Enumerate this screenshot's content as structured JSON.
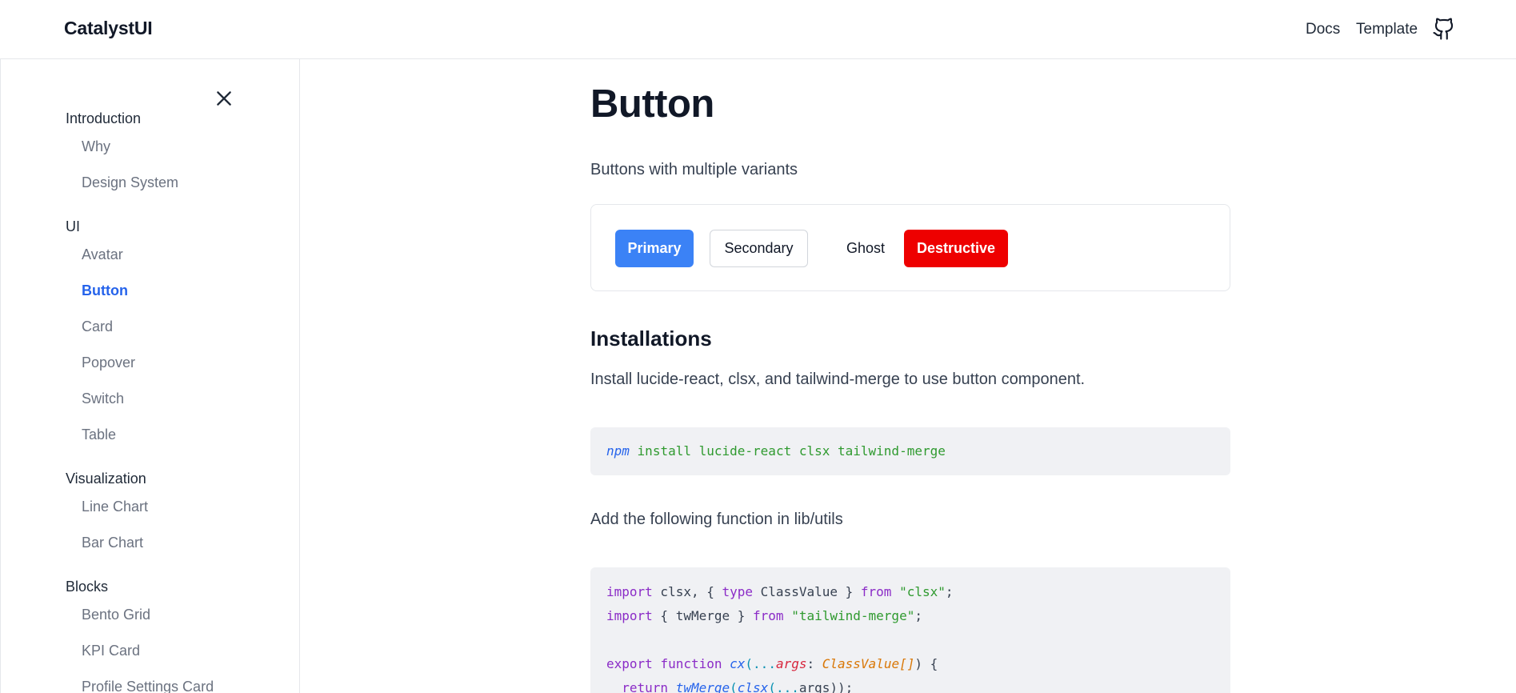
{
  "header": {
    "brand": "CatalystUI",
    "links": [
      "Docs",
      "Template"
    ],
    "github_icon": "github-icon"
  },
  "sidebar": {
    "close_icon": "close-icon",
    "groups": [
      {
        "label": "Introduction",
        "items": [
          "Why",
          "Design System"
        ]
      },
      {
        "label": "UI",
        "items": [
          "Avatar",
          "Button",
          "Card",
          "Popover",
          "Switch",
          "Table"
        ]
      },
      {
        "label": "Visualization",
        "items": [
          "Line Chart",
          "Bar Chart"
        ]
      },
      {
        "label": "Blocks",
        "items": [
          "Bento Grid",
          "KPI Card",
          "Profile Settings Card"
        ]
      }
    ],
    "active_item": "Button"
  },
  "main": {
    "title": "Button",
    "subtitle": "Buttons with multiple variants",
    "buttons": {
      "primary": "Primary",
      "secondary": "Secondary",
      "ghost": "Ghost",
      "destructive": "Destructive"
    },
    "installations_heading": "Installations",
    "install_text": "Install lucide-react, clsx, and tailwind-merge to use button component.",
    "install_cmd": {
      "bin": "npm",
      "args": "install lucide-react clsx tailwind-merge"
    },
    "utils_text": "Add the following function in lib/utils",
    "code": {
      "l1_import": "import",
      "l1_mid": " clsx, { ",
      "l1_type": "type",
      "l1_mid2": " ClassValue } ",
      "l1_from": "from",
      "l1_str": "\"clsx\"",
      "l1_end": ";",
      "l2_import": "import",
      "l2_mid": " { twMerge } ",
      "l2_from": "from",
      "l2_str": "\"tailwind-merge\"",
      "l2_end": ";",
      "l3_export": "export",
      "l3_function": "function",
      "l3_name": "cx",
      "l3_paren": "(",
      "l3_spread": "...",
      "l3_arg": "args",
      "l3_colon": ": ",
      "l3_type": "ClassValue[]",
      "l3_end": ") {",
      "l4_return": "return",
      "l4_fn": "twMerge",
      "l4_paren": "(",
      "l4_fn2": "clsx",
      "l4_paren2": "(",
      "l4_spread": "...",
      "l4_rest": "args));"
    }
  },
  "colors": {
    "primary": "#3b82f6",
    "destructive": "#ee0000",
    "active_link": "#2563eb",
    "code_bg": "#f0f1f4"
  }
}
